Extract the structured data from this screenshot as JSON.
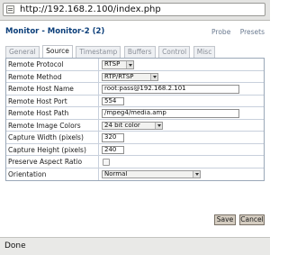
{
  "browser": {
    "url": "http://192.168.2.100/index.php",
    "status": "Done"
  },
  "header": {
    "title": "Monitor - Monitor-2 (2)",
    "links": [
      "Probe",
      "Presets"
    ]
  },
  "tabs": [
    {
      "label": "General",
      "active": false
    },
    {
      "label": "Source",
      "active": true
    },
    {
      "label": "Timestamp",
      "active": false
    },
    {
      "label": "Buffers",
      "active": false
    },
    {
      "label": "Control",
      "active": false
    },
    {
      "label": "Misc",
      "active": false
    }
  ],
  "form": {
    "remote_protocol": {
      "label": "Remote Protocol",
      "value": "RTSP"
    },
    "remote_method": {
      "label": "Remote Method",
      "value": "RTP/RTSP"
    },
    "remote_host_name": {
      "label": "Remote Host Name",
      "value": "root:pass@192.168.2.101"
    },
    "remote_host_port": {
      "label": "Remote Host Port",
      "value": "554"
    },
    "remote_host_path": {
      "label": "Remote Host Path",
      "value": "/mpeg4/media.amp"
    },
    "remote_image_colors": {
      "label": "Remote Image Colors",
      "value": "24 bit color"
    },
    "capture_width": {
      "label": "Capture Width (pixels)",
      "value": "320"
    },
    "capture_height": {
      "label": "Capture Height (pixels)",
      "value": "240"
    },
    "preserve_aspect_ratio": {
      "label": "Preserve Aspect Ratio",
      "checked": false
    },
    "orientation": {
      "label": "Orientation",
      "value": "Normal"
    }
  },
  "buttons": {
    "save": "Save",
    "cancel": "Cancel"
  }
}
